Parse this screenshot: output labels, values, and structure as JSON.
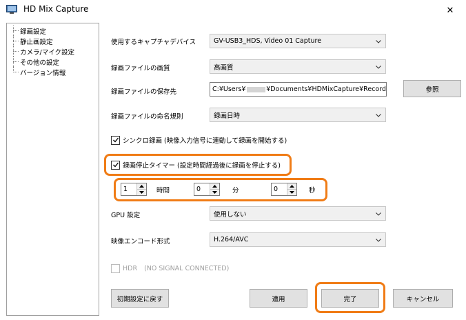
{
  "window": {
    "title": "HD Mix Capture",
    "close_glyph": "✕"
  },
  "sidebar": {
    "items": [
      {
        "label": "録画設定"
      },
      {
        "label": "静止画設定"
      },
      {
        "label": "カメラ/マイク設定"
      },
      {
        "label": "その他の設定"
      },
      {
        "label": "バージョン情報"
      }
    ]
  },
  "settings": {
    "device": {
      "label": "使用するキャプチャデバイス",
      "value": "GV-USB3_HDS, Video 01 Capture"
    },
    "quality": {
      "label": "録画ファイルの画質",
      "value": "高画質"
    },
    "save_path": {
      "label": "録画ファイルの保存先",
      "value_prefix": "C:¥Users¥",
      "value_suffix": "¥Documents¥HDMixCapture¥Record",
      "browse_label": "参照"
    },
    "naming": {
      "label": "録画ファイルの命名規則",
      "value": "録画日時"
    },
    "sync_record": {
      "label": "シンクロ録画 (映像入力信号に連動して録画を開始する)",
      "checked": true
    },
    "stop_timer": {
      "label": "録画停止タイマー (設定時間経過後に録画を停止する)",
      "checked": true
    },
    "timer": {
      "hours": {
        "value": "1",
        "unit": "時間"
      },
      "minutes": {
        "value": "0",
        "unit": "分"
      },
      "seconds": {
        "value": "0",
        "unit": "秒"
      }
    },
    "gpu": {
      "label": "GPU 設定",
      "value": "使用しない"
    },
    "encode": {
      "label": "映像エンコード形式",
      "value": "H.264/AVC"
    },
    "hdr": {
      "label": "HDR",
      "status": "(NO SIGNAL CONNECTED)",
      "checked": false,
      "enabled": false
    }
  },
  "buttons": {
    "reset": "初期設定に戻す",
    "apply": "適用",
    "done": "完了",
    "cancel": "キャンセル"
  },
  "colors": {
    "highlight": "#f07c16"
  }
}
